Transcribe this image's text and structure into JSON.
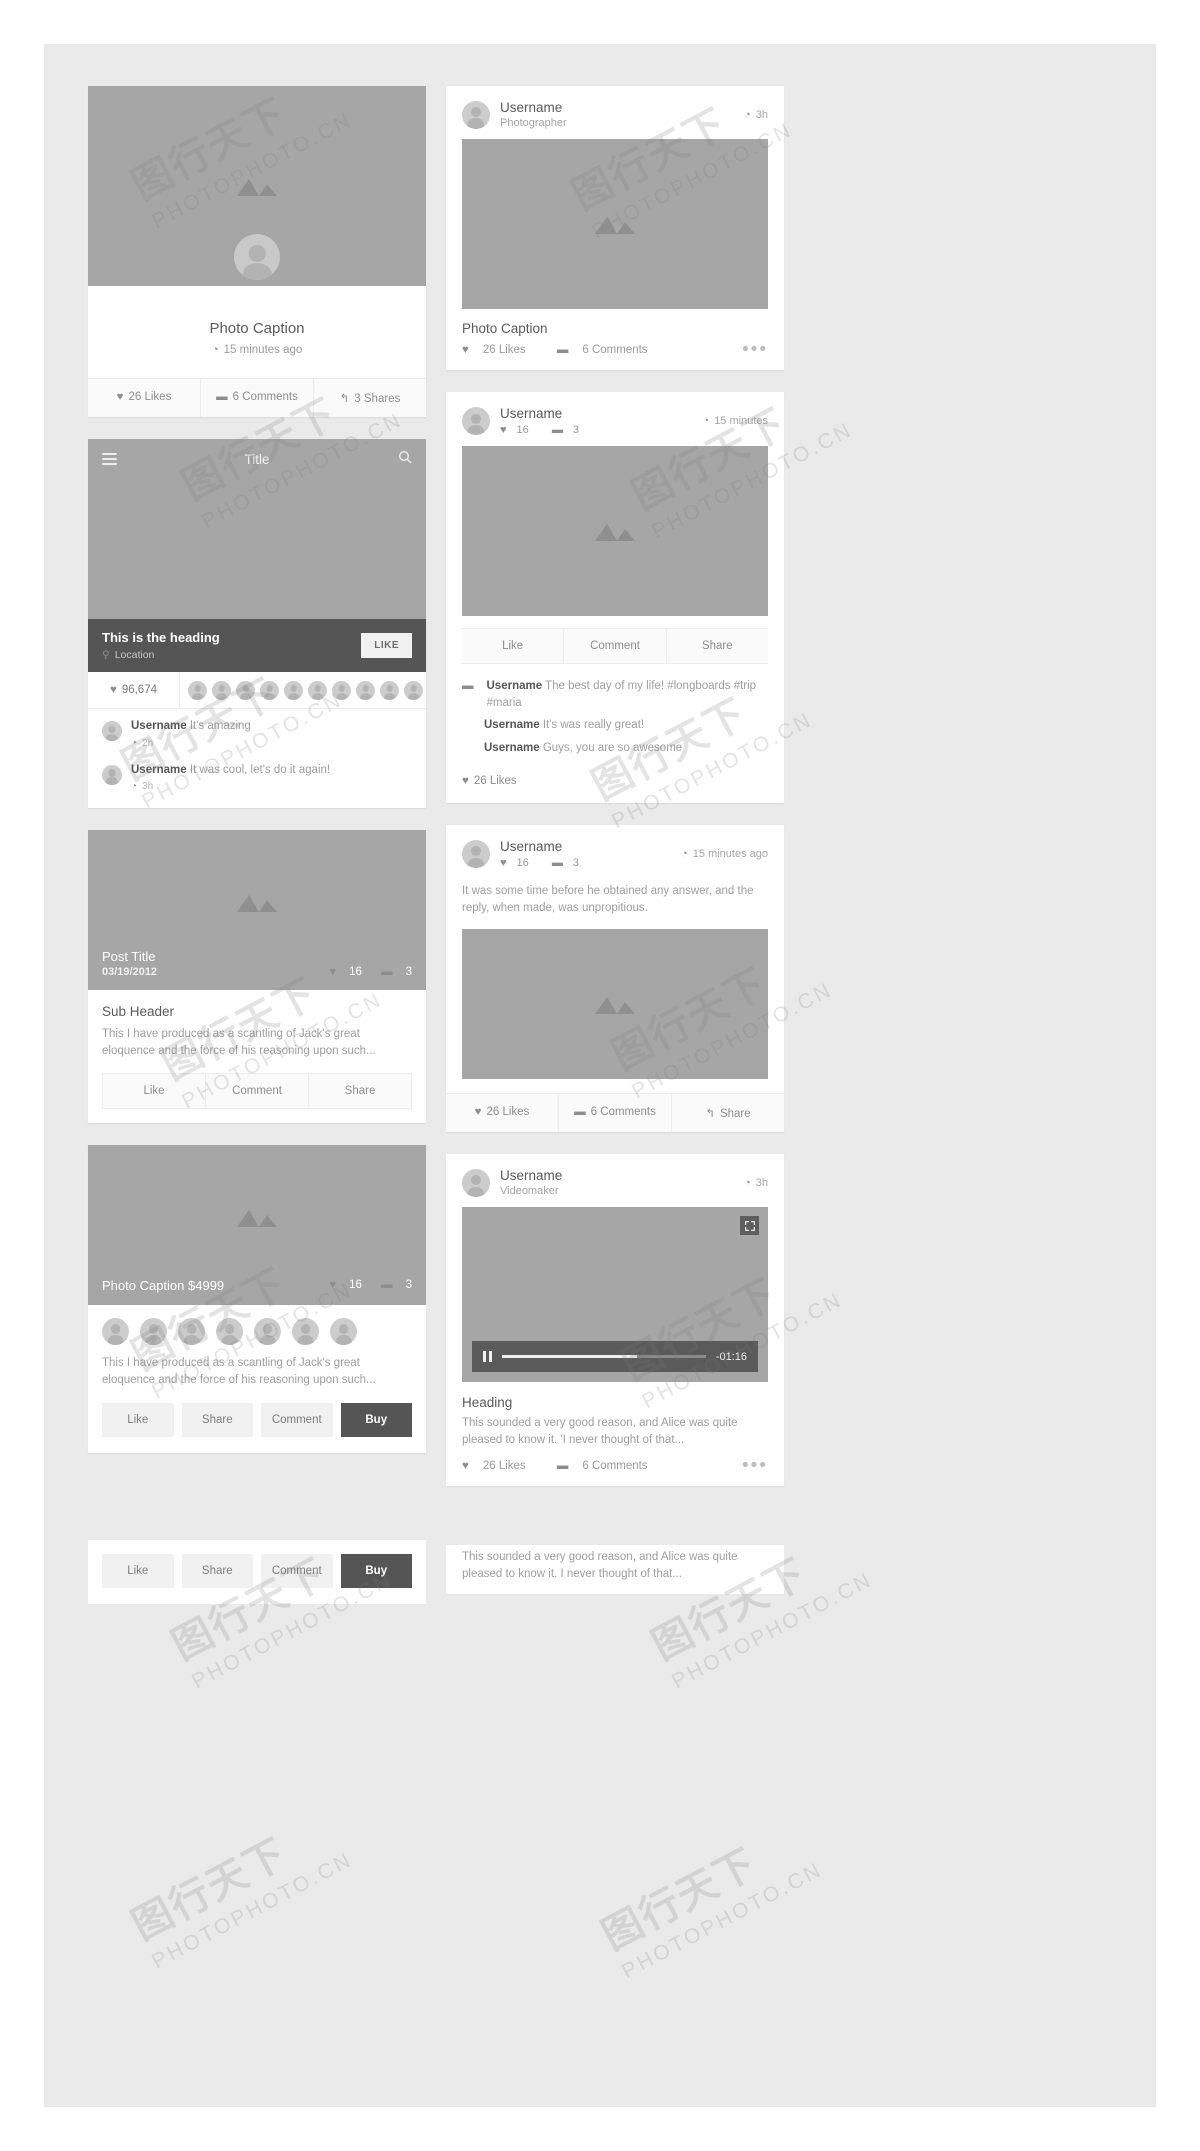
{
  "watermark": {
    "cjk": "图行天下",
    "latin": "PHOTOPHOTO.CN"
  },
  "left_column": {
    "card_photo_caption": {
      "caption": "Photo Caption",
      "time": "15 minutes ago",
      "clock_icon": "clock-icon",
      "actions": [
        {
          "icon": "heart-icon",
          "label": "26 Likes"
        },
        {
          "icon": "comment-icon",
          "label": "6 Comments"
        },
        {
          "icon": "share-icon",
          "label": "3 Shares"
        }
      ]
    },
    "card_app_header": {
      "menu_icon": "hamburger-icon",
      "title": "Title",
      "search_icon": "search-icon",
      "heading": "This is the heading",
      "location": "Location",
      "location_icon": "pin-icon",
      "like_button": "LIKE",
      "likes_count": "96,674",
      "heart_icon": "heart-icon",
      "comments": [
        {
          "user": "Username",
          "text": "It's amazing",
          "time": "2h"
        },
        {
          "user": "Username",
          "text": "It was cool, let's do it again!",
          "time": "3h"
        }
      ]
    },
    "card_post": {
      "title": "Post Title",
      "date": "03/19/2012",
      "likes": "16",
      "comments": "3",
      "sub_header": "Sub Header",
      "body": "This I have produced as a scantling of Jack's great eloquence and the force of his reasoning upon such...",
      "buttons": [
        "Like",
        "Comment",
        "Share"
      ]
    },
    "card_product": {
      "caption": "Photo Caption $4999",
      "likes": "16",
      "comments": "3",
      "body": "This I have produced as a scantling of Jack's great eloquence and the force of his reasoning upon such...",
      "buttons": [
        "Like",
        "Share",
        "Comment"
      ],
      "primary_button": "Buy"
    }
  },
  "right_column": {
    "card_photographer": {
      "username": "Username",
      "role": "Photographer",
      "time": "3h",
      "caption": "Photo Caption",
      "likes": "26 Likes",
      "comments": "6 Comments",
      "more_icon": "more-dots-icon"
    },
    "card_feed": {
      "username": "Username",
      "likes": "16",
      "comments": "3",
      "time": "15 minutes",
      "actions": [
        "Like",
        "Comment",
        "Share"
      ],
      "comment_list": [
        {
          "user": "Username",
          "text": "The best day of my life! #longboards #trip #maria"
        },
        {
          "user": "Username",
          "text": "It's was really great!"
        },
        {
          "user": "Username",
          "text": "Guys, you are so awesome"
        }
      ],
      "likes_summary": "26 Likes"
    },
    "card_text_post": {
      "username": "Username",
      "likes": "16",
      "comments": "3",
      "time": "15 minutes ago",
      "body": "It was some time before he obtained any answer, and the reply, when made, was unpropitious.",
      "actions": [
        {
          "icon": "heart-icon",
          "label": "26 Likes"
        },
        {
          "icon": "comment-icon",
          "label": "6 Comments"
        },
        {
          "icon": "share-icon",
          "label": "Share"
        }
      ]
    },
    "card_video": {
      "username": "Username",
      "role": "Videomaker",
      "time": "3h",
      "expand_icon": "expand-icon",
      "pause_icon": "pause-icon",
      "timecode": "-01:16",
      "heading": "Heading",
      "body": "This sounded a very good reason, and Alice was quite pleased to know it. 'I never thought of that...",
      "likes": "26 Likes",
      "comments": "6 Comments",
      "more_icon": "more-dots-icon"
    }
  },
  "bottom_crop": {
    "buttons": [
      "Like",
      "Share",
      "Comment"
    ],
    "primary_button": "Buy",
    "body": "This sounded a very good reason, and Alice was quite pleased to know it. I never thought of that..."
  }
}
